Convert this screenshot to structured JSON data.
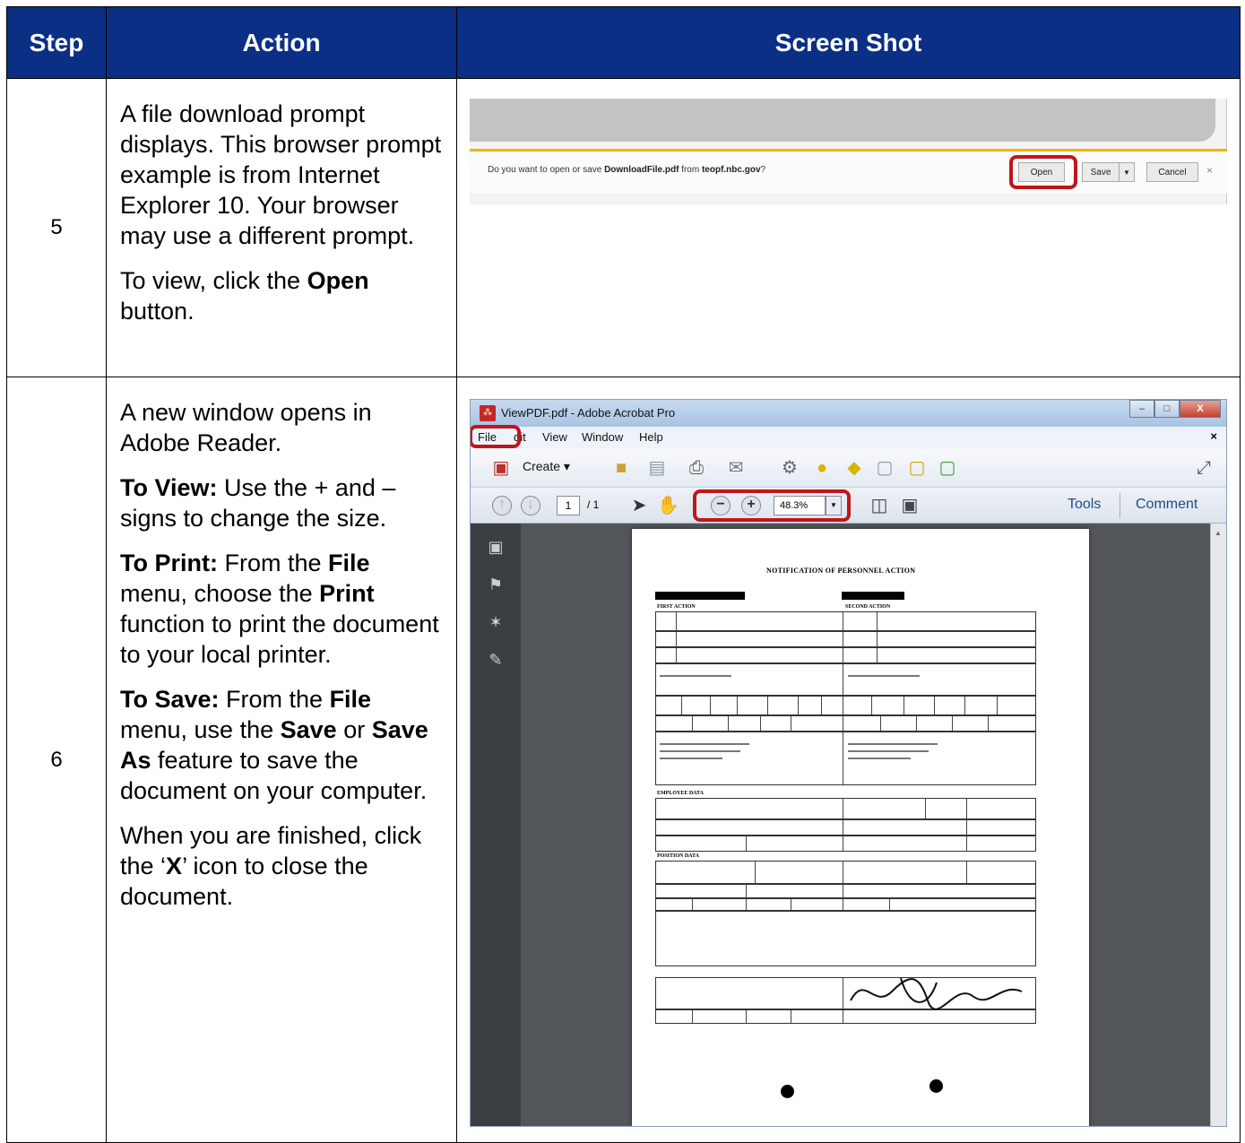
{
  "headers": {
    "step": "Step",
    "action": "Action",
    "screenshot": "Screen Shot"
  },
  "rows": [
    {
      "step": "5",
      "paragraphs": [
        "A file download prompt displays.  This browser prompt example is from Internet Explorer 10.  Your browser may use a different prompt.",
        [
          "To view, click the ",
          {
            "b": "Open"
          },
          " button."
        ]
      ]
    },
    {
      "step": "6",
      "paragraphs": [
        "A new window opens in Adobe Reader.",
        [
          {
            "b": "To View:"
          },
          " Use the + and – signs to change the size."
        ],
        [
          {
            "b": "To Print:"
          },
          " From the ",
          {
            "b": "File"
          },
          " menu, choose the ",
          {
            "b": "Print"
          },
          " function to print the document to your local printer."
        ],
        [
          {
            "b": "To Save:"
          },
          " From the ",
          {
            "b": "File"
          },
          " menu, use the ",
          {
            "b": "Save"
          },
          " or ",
          {
            "b": "Save As"
          },
          " feature to save the document on your computer."
        ],
        [
          "When you are finished, click the ‘",
          {
            "b": "X"
          },
          "’ icon to close the document."
        ]
      ]
    }
  ],
  "ie_prompt": {
    "message_pre": "Do you want to open or save ",
    "file_name": "DownloadFile.pdf",
    "message_mid": " from ",
    "host": "teopf.nbc.gov",
    "message_post": "?",
    "open_label": "Open",
    "save_label": "Save",
    "save_arrow": "▼",
    "cancel_label": "Cancel",
    "close_glyph": "×"
  },
  "acrobat": {
    "title": "ViewPDF.pdf - Adobe Acrobat Pro",
    "menu": [
      "File",
      "dit",
      "View",
      "Window",
      "Help"
    ],
    "menu_close": "×",
    "create_label": "Create ▾",
    "page_current": "1",
    "page_total": "/ 1",
    "zoom_value": "48.3%",
    "zoom_arrow": "▼",
    "minus": "−",
    "plus": "+",
    "tools_label": "Tools",
    "comment_label": "Comment",
    "window_buttons": [
      "–",
      "□",
      "X"
    ],
    "logo": "⁂",
    "scroll_up": "▲"
  },
  "pdf": {
    "title": "NOTIFICATION OF PERSONNEL ACTION",
    "section_first": "FIRST ACTION",
    "section_second": "SECOND ACTION",
    "section_employee": "EMPLOYEE DATA",
    "section_position": "POSITION DATA"
  },
  "colors": {
    "header_bg": "#0b2f84",
    "highlight_red": "#c0161c",
    "ie_bar_accent": "#f0b400"
  }
}
